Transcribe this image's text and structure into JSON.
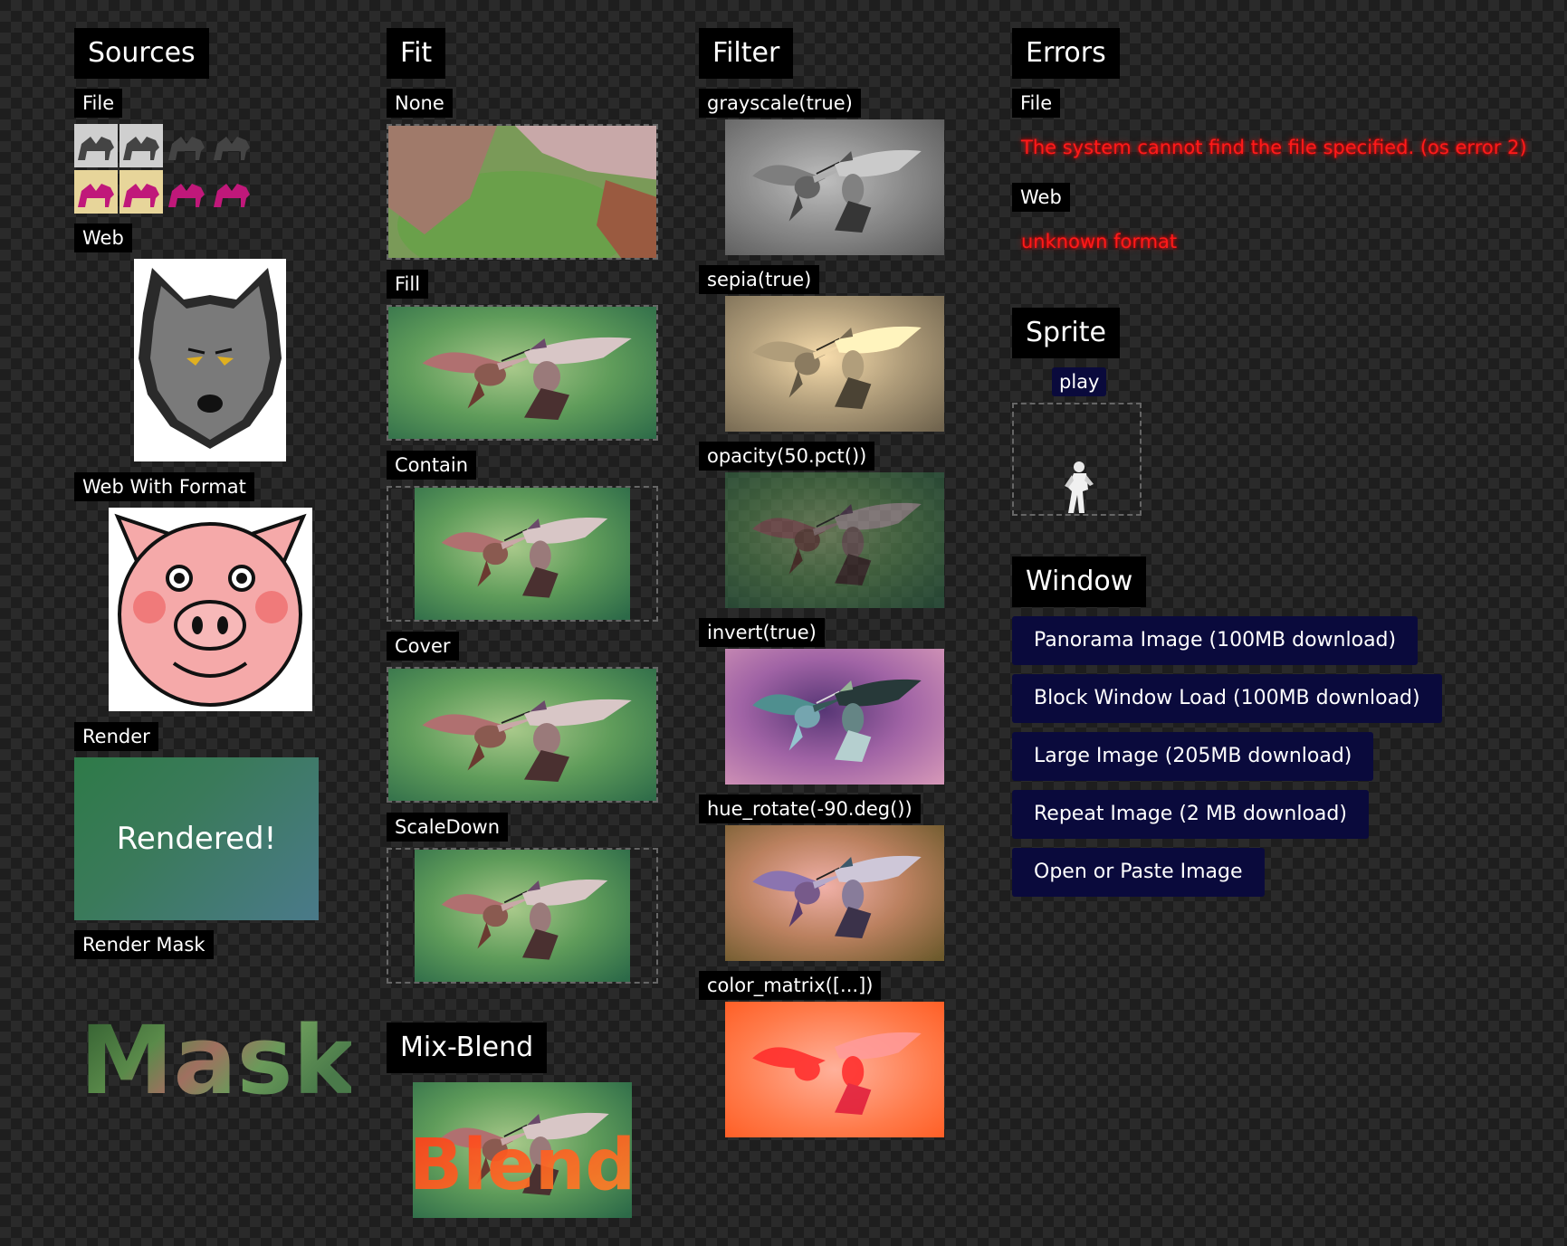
{
  "sources": {
    "heading": "Sources",
    "file_label": "File",
    "web_label": "Web",
    "web_format_label": "Web With Format",
    "render_label": "Render",
    "rendered_text": "Rendered!",
    "render_mask_label": "Render Mask",
    "mask_text": "Mask"
  },
  "fit": {
    "heading": "Fit",
    "modes": [
      "None",
      "Fill",
      "Contain",
      "Cover",
      "ScaleDown"
    ]
  },
  "mix_blend": {
    "heading": "Mix-Blend",
    "blend_text": "Blend"
  },
  "filter": {
    "heading": "Filter",
    "items": [
      "grayscale(true)",
      "sepia(true)",
      "opacity(50.pct())",
      "invert(true)",
      "hue_rotate(-90.deg())",
      "color_matrix([...])"
    ]
  },
  "errors": {
    "heading": "Errors",
    "file_label": "File",
    "file_error": "The system cannot find the file specified. (os error 2)",
    "web_label": "Web",
    "web_error": "unknown format"
  },
  "sprite": {
    "heading": "Sprite",
    "play_label": "play"
  },
  "window": {
    "heading": "Window",
    "buttons": [
      "Panorama Image (100MB download)",
      "Block Window Load (100MB download)",
      "Large Image (205MB download)",
      "Repeat Image (2 MB download)",
      "Open or Paste Image"
    ]
  },
  "colors": {
    "error_red": "#ff1a1a",
    "button_bg": "#0a0a3c",
    "render_green": "#2f7a45"
  }
}
